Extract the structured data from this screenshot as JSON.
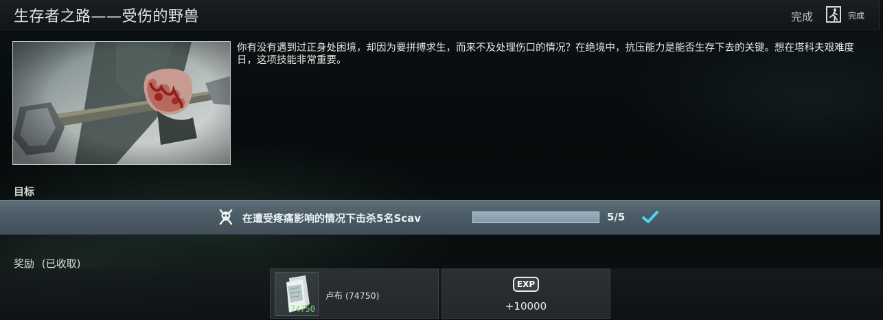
{
  "quest": {
    "title": "生存者之路——受伤的野兽",
    "status": "完成",
    "status_small": "完成",
    "description": "你有没有遇到过正身处困境，却因为要拼搏求生，而来不及处理伤口的情况？在绝境中，抗压能力是能否生存下去的关键。想在塔科夫艰难度日，这项技能非常重要。"
  },
  "objectives": {
    "label": "目标",
    "items": [
      {
        "text": "在遭受疼痛影响的情况下击杀5名Scav",
        "progress_text": "5/5",
        "progress_fraction": 1.0,
        "completed": true
      }
    ]
  },
  "rewards": {
    "label": "奖励",
    "status": "(已收取)",
    "items": [
      {
        "name": "卢布 (74750)",
        "quantity": "74750",
        "icon": "roubles-icon"
      },
      {
        "badge": "EXP",
        "value": "+10000",
        "icon": "exp-icon"
      }
    ]
  },
  "colors": {
    "objective_bar": "#4c5c66",
    "check": "#4fd3f0",
    "item_quantity": "#7fd86b"
  }
}
